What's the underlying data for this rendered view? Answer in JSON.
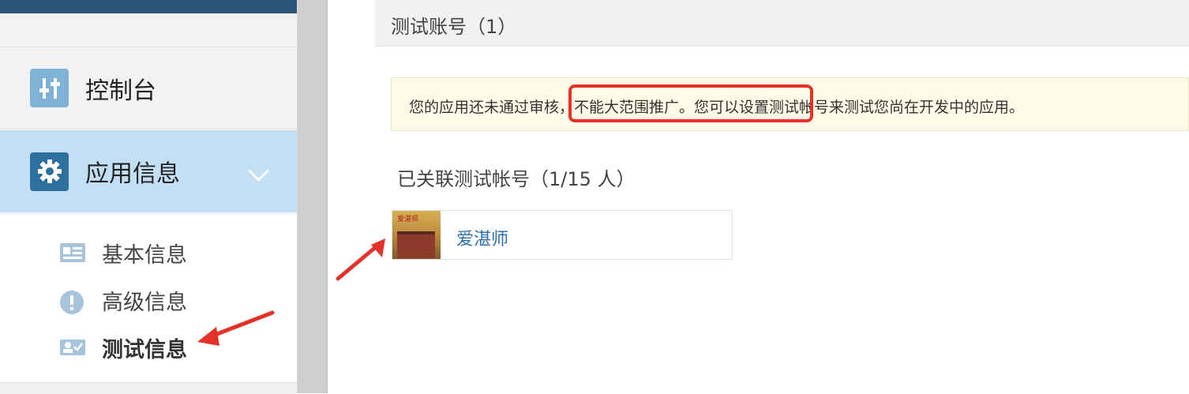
{
  "sidebar": {
    "nav": [
      {
        "label": "控制台",
        "icon": "sliders-icon",
        "color": "#6aa7cf"
      },
      {
        "label": "应用信息",
        "icon": "gear-icon",
        "color": "#2d6f9e"
      }
    ],
    "submenu": [
      {
        "label": "基本信息",
        "icon": "id-card-icon"
      },
      {
        "label": "高级信息",
        "icon": "exclamation-icon"
      },
      {
        "label": "测试信息",
        "icon": "user-check-icon",
        "active": true
      }
    ]
  },
  "main": {
    "section_title": "测试账号（1）",
    "notice": {
      "before": "您的应用还",
      "highlight": "未通过审核，不能大范围推广",
      "after": "。您可以设置测试帐号来测试您尚在开发中的应用。"
    },
    "list_title": "已关联测试帐号（1/15 人）",
    "accounts": [
      {
        "name": "爱湛师",
        "avatar_text": "爱湛师"
      }
    ]
  },
  "annotation_color": "#e4322b"
}
